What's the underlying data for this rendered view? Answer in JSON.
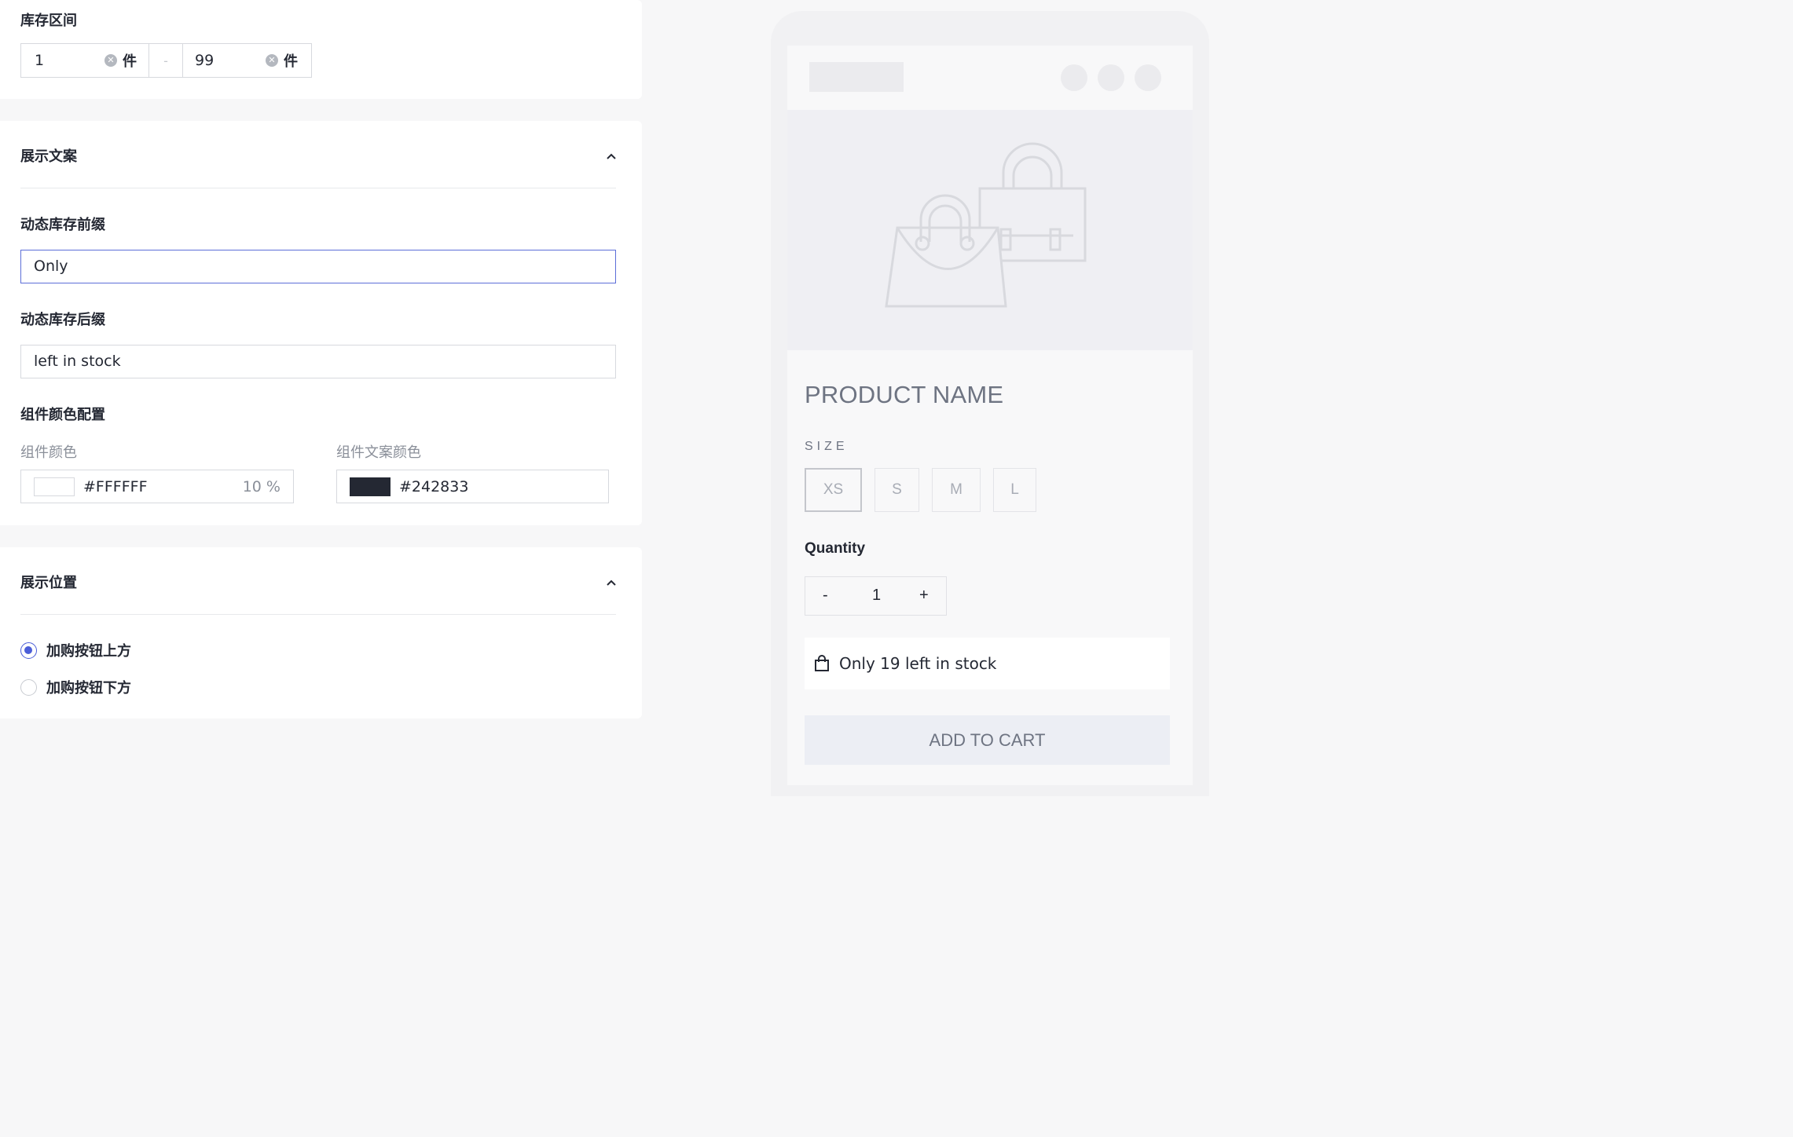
{
  "inventory_range": {
    "title": "库存区间",
    "min_value": "1",
    "max_value": "99",
    "unit": "件",
    "separator": "-"
  },
  "display_text": {
    "title": "展示文案",
    "prefix_label": "动态库存前缀",
    "prefix_value": "Only",
    "suffix_label": "动态库存后缀",
    "suffix_value": "left in stock",
    "color_config_label": "组件颜色配置",
    "component_color_label": "组件颜色",
    "component_color_hex": "#FFFFFF",
    "component_color_opacity": "10 %",
    "text_color_label": "组件文案颜色",
    "text_color_hex": "#242833"
  },
  "display_position": {
    "title": "展示位置",
    "options": [
      {
        "label": "加购按钮上方",
        "checked": true
      },
      {
        "label": "加购按钮下方",
        "checked": false
      }
    ]
  },
  "preview": {
    "product_name": "PRODUCT NAME",
    "size_label": "SIZE",
    "sizes": [
      "XS",
      "S",
      "M",
      "L"
    ],
    "selected_size": "XS",
    "quantity_label": "Quantity",
    "qty_minus": "-",
    "qty_value": "1",
    "qty_plus": "+",
    "stock_message": "Only 19 left in stock",
    "add_to_cart": "ADD TO CART"
  },
  "colors": {
    "accent": "#4b5ed8",
    "text": "#242833",
    "muted": "#8a8f99"
  }
}
